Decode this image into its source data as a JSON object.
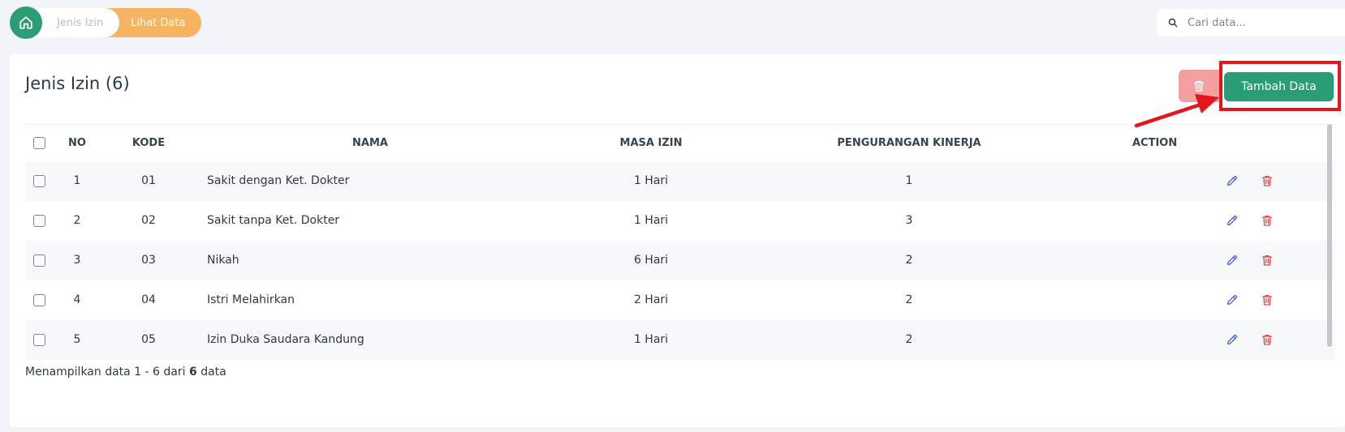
{
  "breadcrumb": {
    "items": [
      "Jenis Izin",
      "Lihat Data"
    ]
  },
  "search": {
    "placeholder": "Cari data..."
  },
  "card": {
    "title": "Jenis Izin (6)",
    "add_label": "Tambah Data"
  },
  "table": {
    "headers": [
      "NO",
      "KODE",
      "NAMA",
      "MASA IZIN",
      "PENGURANGAN KINERJA",
      "ACTION"
    ],
    "rows": [
      {
        "no": "1",
        "kode": "01",
        "nama": "Sakit dengan Ket. Dokter",
        "masa": "1 Hari",
        "kinerja": "1"
      },
      {
        "no": "2",
        "kode": "02",
        "nama": "Sakit tanpa Ket. Dokter",
        "masa": "1 Hari",
        "kinerja": "3"
      },
      {
        "no": "3",
        "kode": "03",
        "nama": "Nikah",
        "masa": "6 Hari",
        "kinerja": "2"
      },
      {
        "no": "4",
        "kode": "04",
        "nama": "Istri Melahirkan",
        "masa": "2 Hari",
        "kinerja": "2"
      },
      {
        "no": "5",
        "kode": "05",
        "nama": "Izin Duka Saudara Kandung",
        "masa": "1 Hari",
        "kinerja": "2"
      }
    ]
  },
  "footer": {
    "prefix": "Menampilkan data 1 - 6 dari",
    "total": "6",
    "suffix": "data"
  },
  "colors": {
    "primary": "#2a9d77",
    "accent": "#f6b460",
    "danger_light": "#f5a0a0",
    "highlight": "#e3161c",
    "edit": "#4a5fd1",
    "delete": "#e04848"
  },
  "icons": {
    "home": "home-icon",
    "search": "search-icon",
    "trash": "trash-icon",
    "edit": "pencil-icon"
  }
}
